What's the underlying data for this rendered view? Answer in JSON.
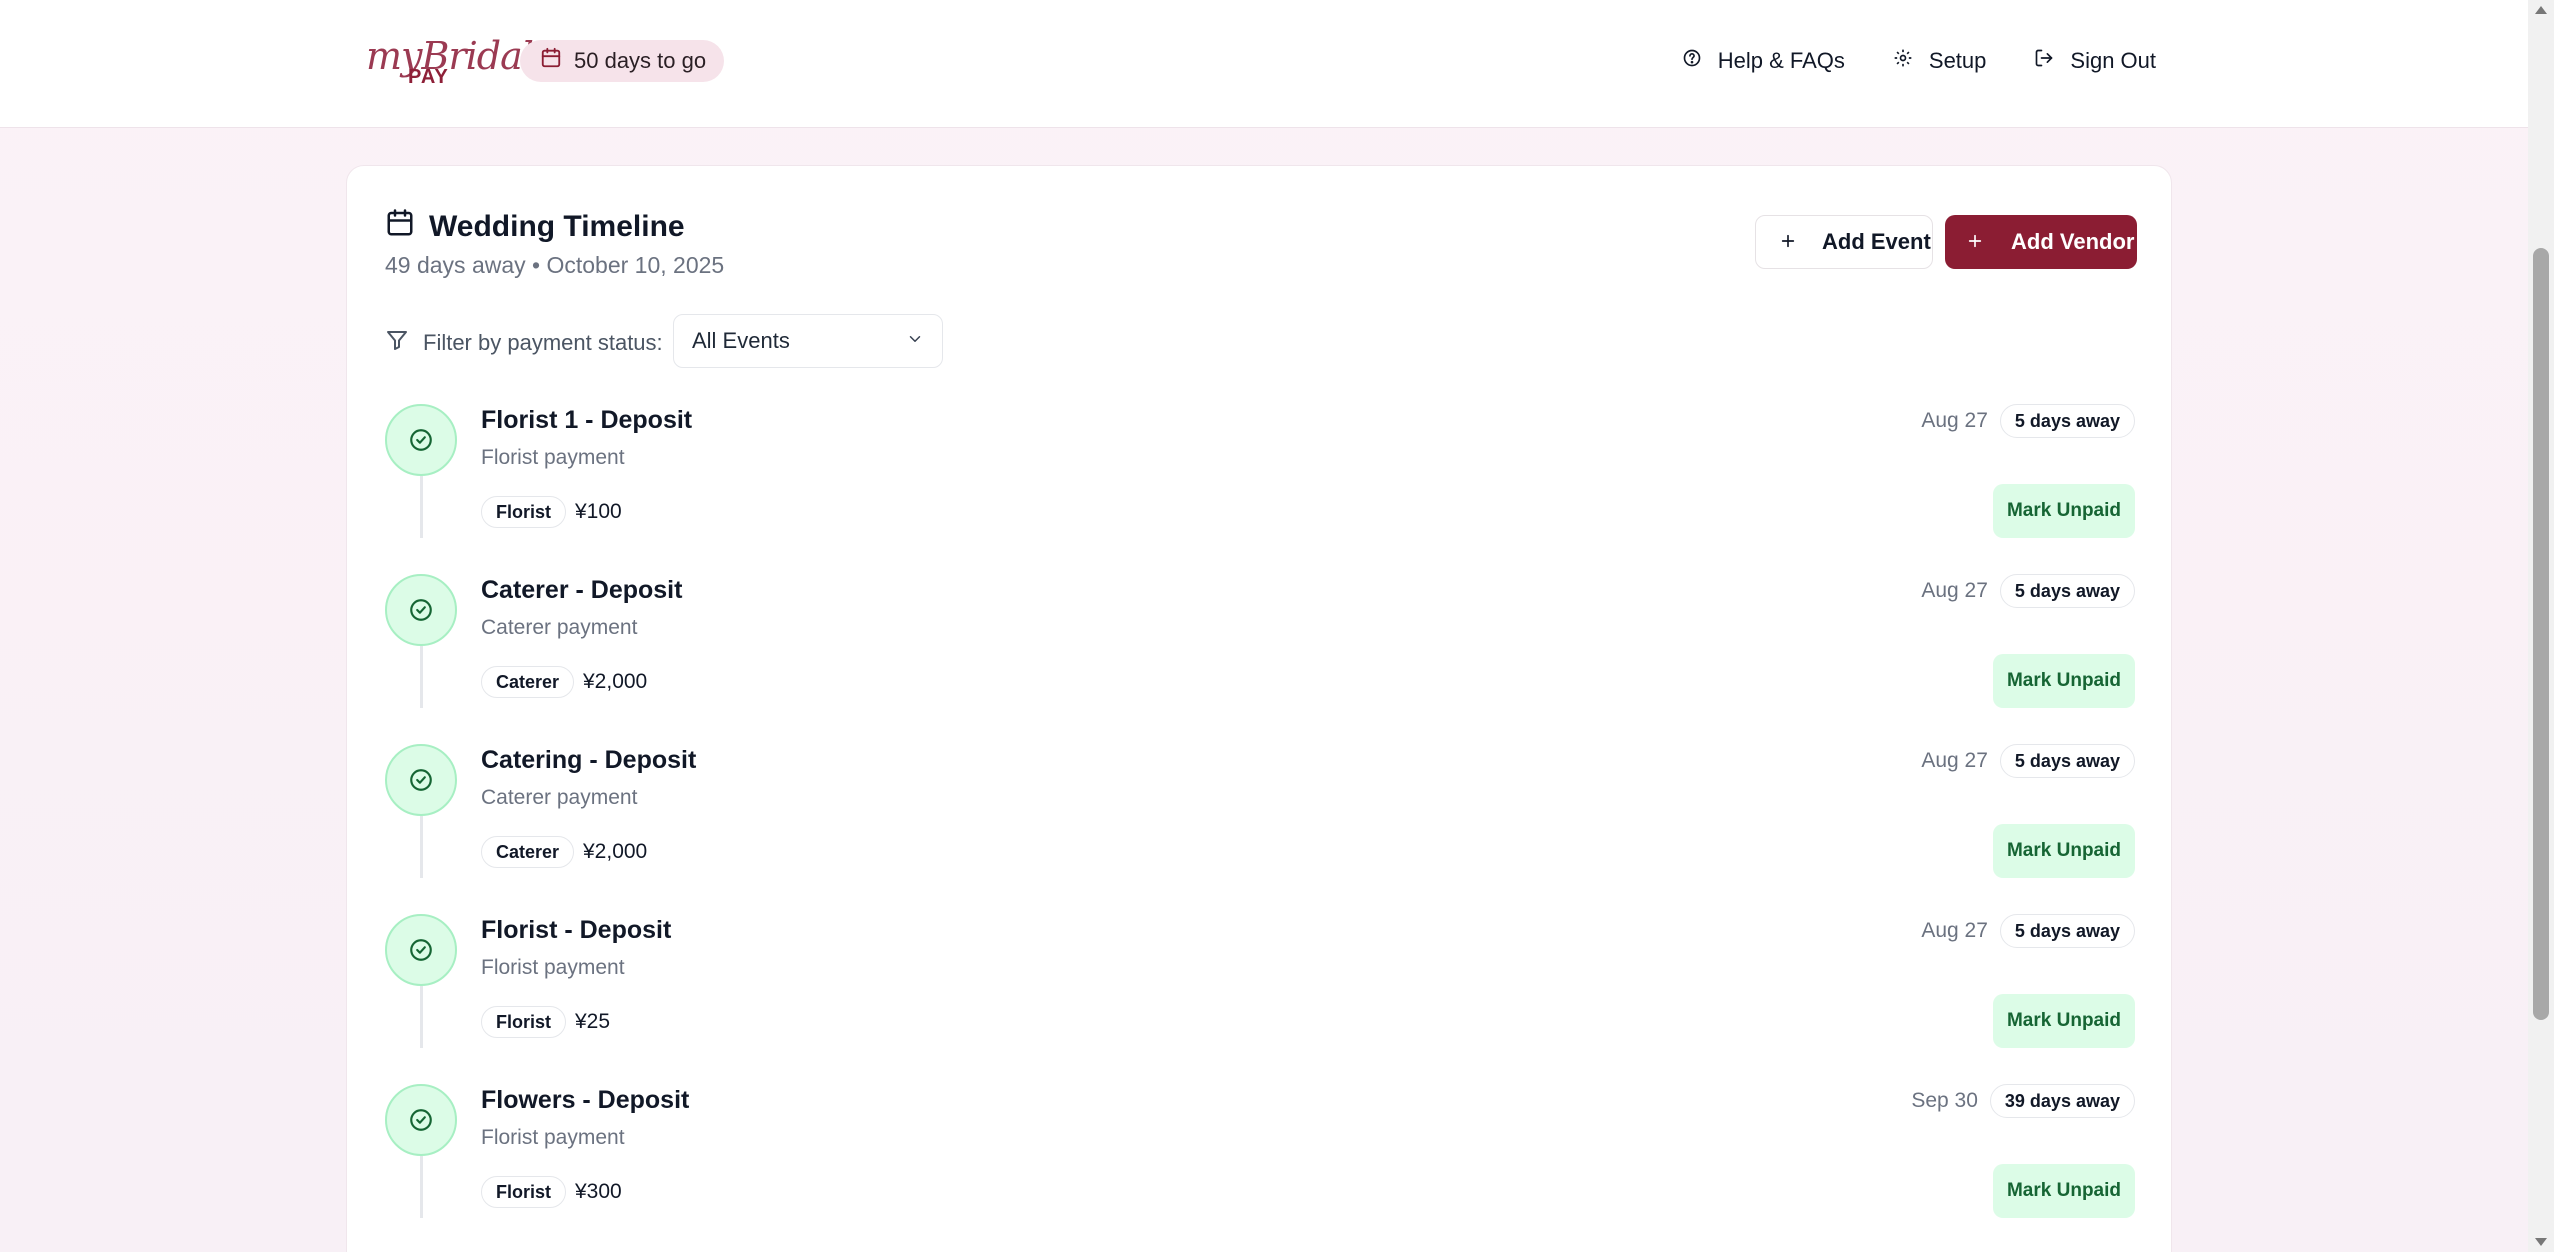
{
  "header": {
    "logo_script": "myBridal",
    "logo_pay": "PAY",
    "countdown": "50 days to go",
    "nav": {
      "help": "Help & FAQs",
      "setup": "Setup",
      "signout": "Sign Out"
    }
  },
  "timeline": {
    "title": "Wedding Timeline",
    "subtitle": "49 days away • October 10, 2025",
    "add_event": "Add Event",
    "add_vendor": "Add Vendor",
    "filter_label": "Filter by payment status:",
    "filter_value": "All Events"
  },
  "events": [
    {
      "title": "Florist 1 - Deposit",
      "subtitle": "Florist payment",
      "tag": "Florist",
      "amount": "¥100",
      "date": "Aug 27",
      "away": "5 days away",
      "action": "Mark Unpaid"
    },
    {
      "title": "Caterer - Deposit",
      "subtitle": "Caterer payment",
      "tag": "Caterer",
      "amount": "¥2,000",
      "date": "Aug 27",
      "away": "5 days away",
      "action": "Mark Unpaid"
    },
    {
      "title": "Catering - Deposit",
      "subtitle": "Caterer payment",
      "tag": "Caterer",
      "amount": "¥2,000",
      "date": "Aug 27",
      "away": "5 days away",
      "action": "Mark Unpaid"
    },
    {
      "title": "Florist - Deposit",
      "subtitle": "Florist payment",
      "tag": "Florist",
      "amount": "¥25",
      "date": "Aug 27",
      "away": "5 days away",
      "action": "Mark Unpaid"
    },
    {
      "title": "Flowers - Deposit",
      "subtitle": "Florist payment",
      "tag": "Florist",
      "amount": "¥300",
      "date": "Sep 30",
      "away": "39 days away",
      "action": "Mark Unpaid"
    }
  ],
  "colors": {
    "brand": "#8b1d33",
    "paid_bg": "#dcfce7",
    "paid_text": "#166534"
  }
}
